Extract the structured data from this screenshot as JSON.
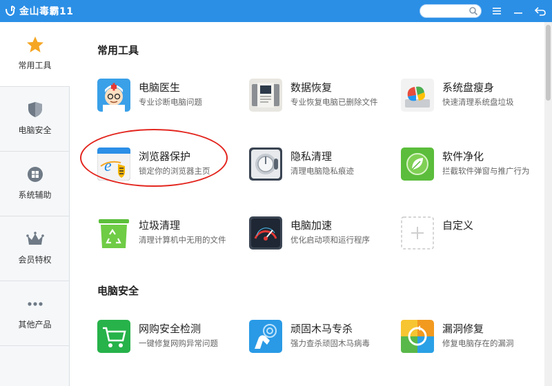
{
  "app": {
    "title": "金山毒霸11"
  },
  "search": {
    "placeholder": ""
  },
  "window_controls": {
    "menu_icon": "menu-icon",
    "minimize_icon": "minimize-icon",
    "back_icon": "back-arrow-icon"
  },
  "sidebar": {
    "items": [
      {
        "label": "常用工具",
        "icon": "star-icon",
        "active": true
      },
      {
        "label": "电脑安全",
        "icon": "shield-icon",
        "active": false
      },
      {
        "label": "系统辅助",
        "icon": "windows-logo-icon",
        "active": false
      },
      {
        "label": "会员特权",
        "icon": "crown-icon",
        "active": false
      },
      {
        "label": "其他产品",
        "icon": "more-dots-icon",
        "active": false
      }
    ]
  },
  "sections": [
    {
      "title": "常用工具",
      "tools": [
        {
          "name": "电脑医生",
          "desc": "专业诊断电脑问题",
          "icon": "doctor-icon"
        },
        {
          "name": "数据恢复",
          "desc": "专业恢复电脑已删除文件",
          "icon": "data-recovery-icon"
        },
        {
          "name": "系统盘瘦身",
          "desc": "快速清理系统盘垃圾",
          "icon": "disk-slim-icon"
        },
        {
          "name": "浏览器保护",
          "desc": "锁定你的浏览器主页",
          "icon": "browser-protect-icon"
        },
        {
          "name": "隐私清理",
          "desc": "清理电脑隐私痕迹",
          "icon": "privacy-clean-icon"
        },
        {
          "name": "软件净化",
          "desc": "拦截软件弹窗与推广行为",
          "icon": "software-purify-icon"
        },
        {
          "name": "垃圾清理",
          "desc": "清理计算机中无用的文件",
          "icon": "recycle-bin-icon"
        },
        {
          "name": "电脑加速",
          "desc": "优化启动项和运行程序",
          "icon": "speedometer-icon"
        },
        {
          "name": "自定义",
          "desc": "",
          "icon": "add-icon"
        }
      ]
    },
    {
      "title": "电脑安全",
      "tools": [
        {
          "name": "网购安全检测",
          "desc": "一键修复网购异常问题",
          "icon": "shopping-cart-icon"
        },
        {
          "name": "顽固木马专杀",
          "desc": "强力查杀顽固木马病毒",
          "icon": "trojan-kill-icon"
        },
        {
          "name": "漏洞修复",
          "desc": "修复电脑存在的漏洞",
          "icon": "patch-repair-icon"
        }
      ]
    }
  ],
  "colors": {
    "titlebar": "#2b8fe6",
    "highlight_ellipse": "#e3261f"
  }
}
